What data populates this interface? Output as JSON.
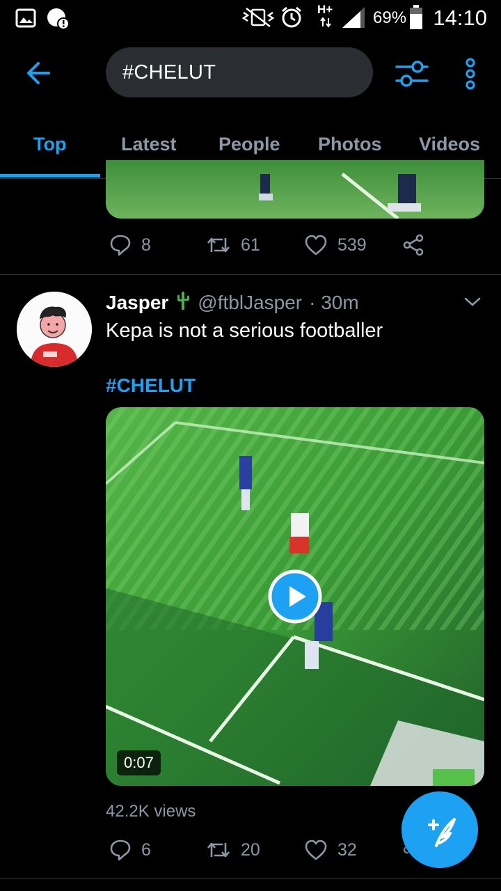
{
  "status_bar": {
    "battery_percent": "69%",
    "time": "14:10",
    "network": "H+"
  },
  "search": {
    "query": "#CHELUT"
  },
  "tabs": [
    {
      "label": "Top",
      "active": true
    },
    {
      "label": "Latest",
      "active": false
    },
    {
      "label": "People",
      "active": false
    },
    {
      "label": "Photos",
      "active": false
    },
    {
      "label": "Videos",
      "active": false
    }
  ],
  "previous_tweet": {
    "replies": "8",
    "retweets": "61",
    "likes": "539"
  },
  "tweet": {
    "name": "Jasper",
    "handle": "@ftblJasper",
    "time": "· 30m",
    "text": "Kepa is not a serious footballer",
    "hashtag": "#CHELUT",
    "video_duration": "0:07",
    "views": "42.2K views",
    "replies": "6",
    "retweets": "20",
    "likes": "32"
  },
  "colors": {
    "accent": "#1da1f2",
    "background": "#000000",
    "muted_text": "#8b98a5",
    "pitch_green": "#3f9a3a"
  }
}
